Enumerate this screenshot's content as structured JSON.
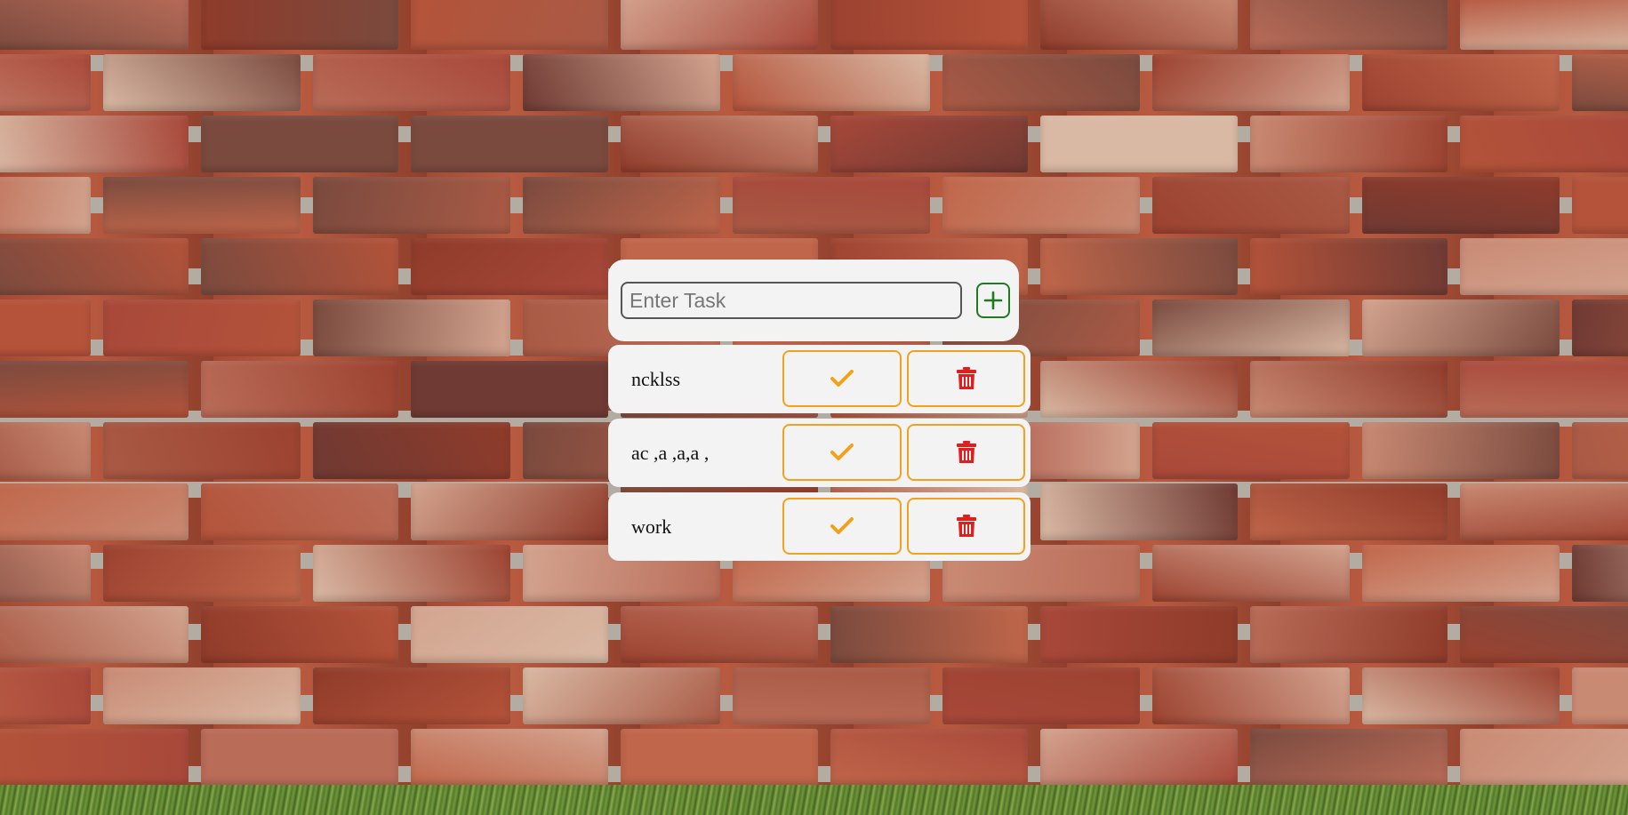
{
  "task_input": {
    "placeholder": "Enter Task",
    "value": ""
  },
  "add_button": {
    "icon": "plus-icon",
    "color": "#1e7a1e"
  },
  "tasks": [
    {
      "text": "ncklss",
      "done_icon": "check-icon",
      "delete_icon": "trash-icon"
    },
    {
      "text": "ac ,a ,a,a ,",
      "done_icon": "check-icon",
      "delete_icon": "trash-icon"
    },
    {
      "text": "work",
      "done_icon": "check-icon",
      "delete_icon": "trash-icon"
    }
  ],
  "colors": {
    "check": "#f2a21a",
    "trash": "#e01e1e",
    "card": "#f3f3f3",
    "button_border": "#f2a21a"
  }
}
